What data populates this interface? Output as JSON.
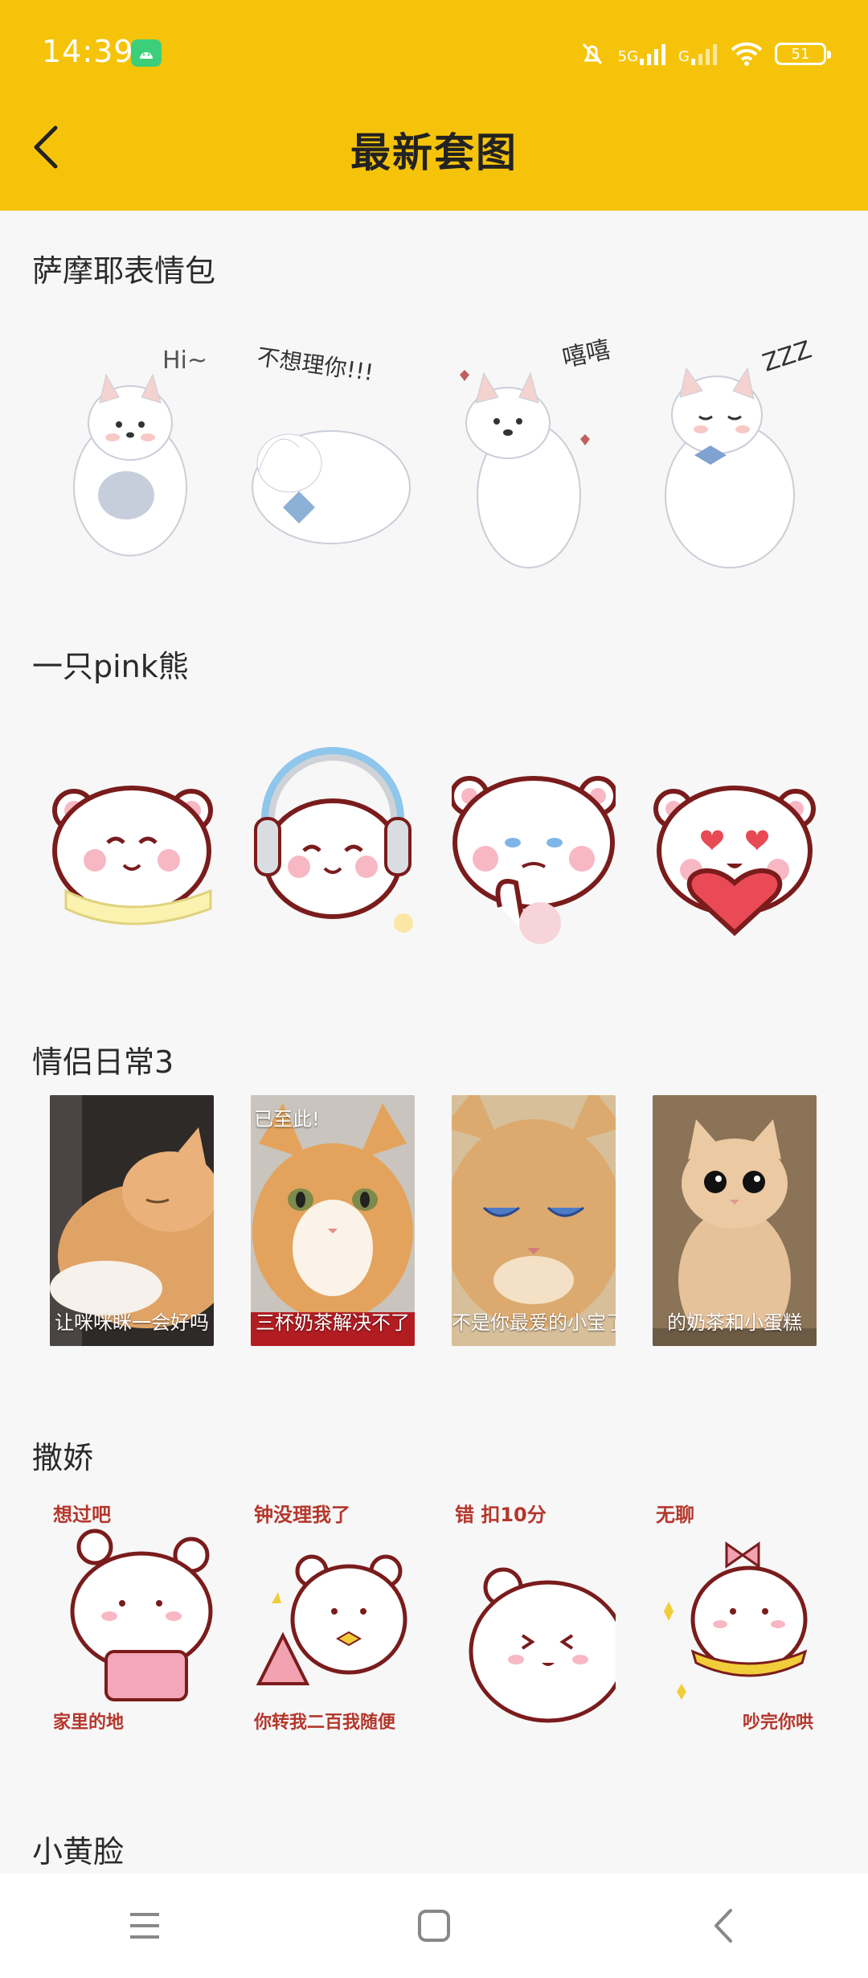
{
  "status": {
    "time": "14:39",
    "network_1": "5G",
    "network_2": "G",
    "battery": "51"
  },
  "header": {
    "title": "最新套图"
  },
  "sections": [
    {
      "title": "萨摩耶表情包",
      "items": [
        {
          "icon": "samoyed-hi-sticker",
          "text": "Hi~"
        },
        {
          "icon": "samoyed-ignore-sticker",
          "text": "不想理你!!!"
        },
        {
          "icon": "samoyed-hehe-sticker",
          "text": "嘻嘻"
        },
        {
          "icon": "samoyed-sleep-sticker",
          "text": "ZZZ"
        }
      ]
    },
    {
      "title": "一只pink熊",
      "items": [
        {
          "icon": "bear-scarf-sticker"
        },
        {
          "icon": "bear-headphones-sticker"
        },
        {
          "icon": "bear-crying-sticker"
        },
        {
          "icon": "bear-heart-sticker"
        }
      ]
    },
    {
      "title": "情侣日常3",
      "items": [
        {
          "icon": "cat-sleeping-photo",
          "caption": "让咪咪眯一会好吗"
        },
        {
          "icon": "cat-smiling-photo",
          "caption": "三杯奶茶解决不了",
          "caption_top": "已至此!"
        },
        {
          "icon": "cat-crying-photo",
          "caption": "不是你最爱的小宝了"
        },
        {
          "icon": "cat-sitting-photo",
          "caption": "的奶茶和小蛋糕"
        }
      ]
    },
    {
      "title": "撒娇",
      "items": [
        {
          "icon": "bear-handbag-sticker",
          "top": "想过吧",
          "bottom": "家里的地"
        },
        {
          "icon": "bear-shopping-sticker",
          "top": "钟没理我了",
          "bottom": "你转我二百我随便"
        },
        {
          "icon": "bear-angry-sticker",
          "top": "错 扣10分",
          "bottom": ""
        },
        {
          "icon": "bear-bow-sticker",
          "top": "无聊",
          "bottom": "吵完你哄"
        }
      ]
    },
    {
      "title": "小黄脸",
      "items": []
    }
  ],
  "colors": {
    "accent": "#f5c30a",
    "background": "#f7f7f7"
  }
}
